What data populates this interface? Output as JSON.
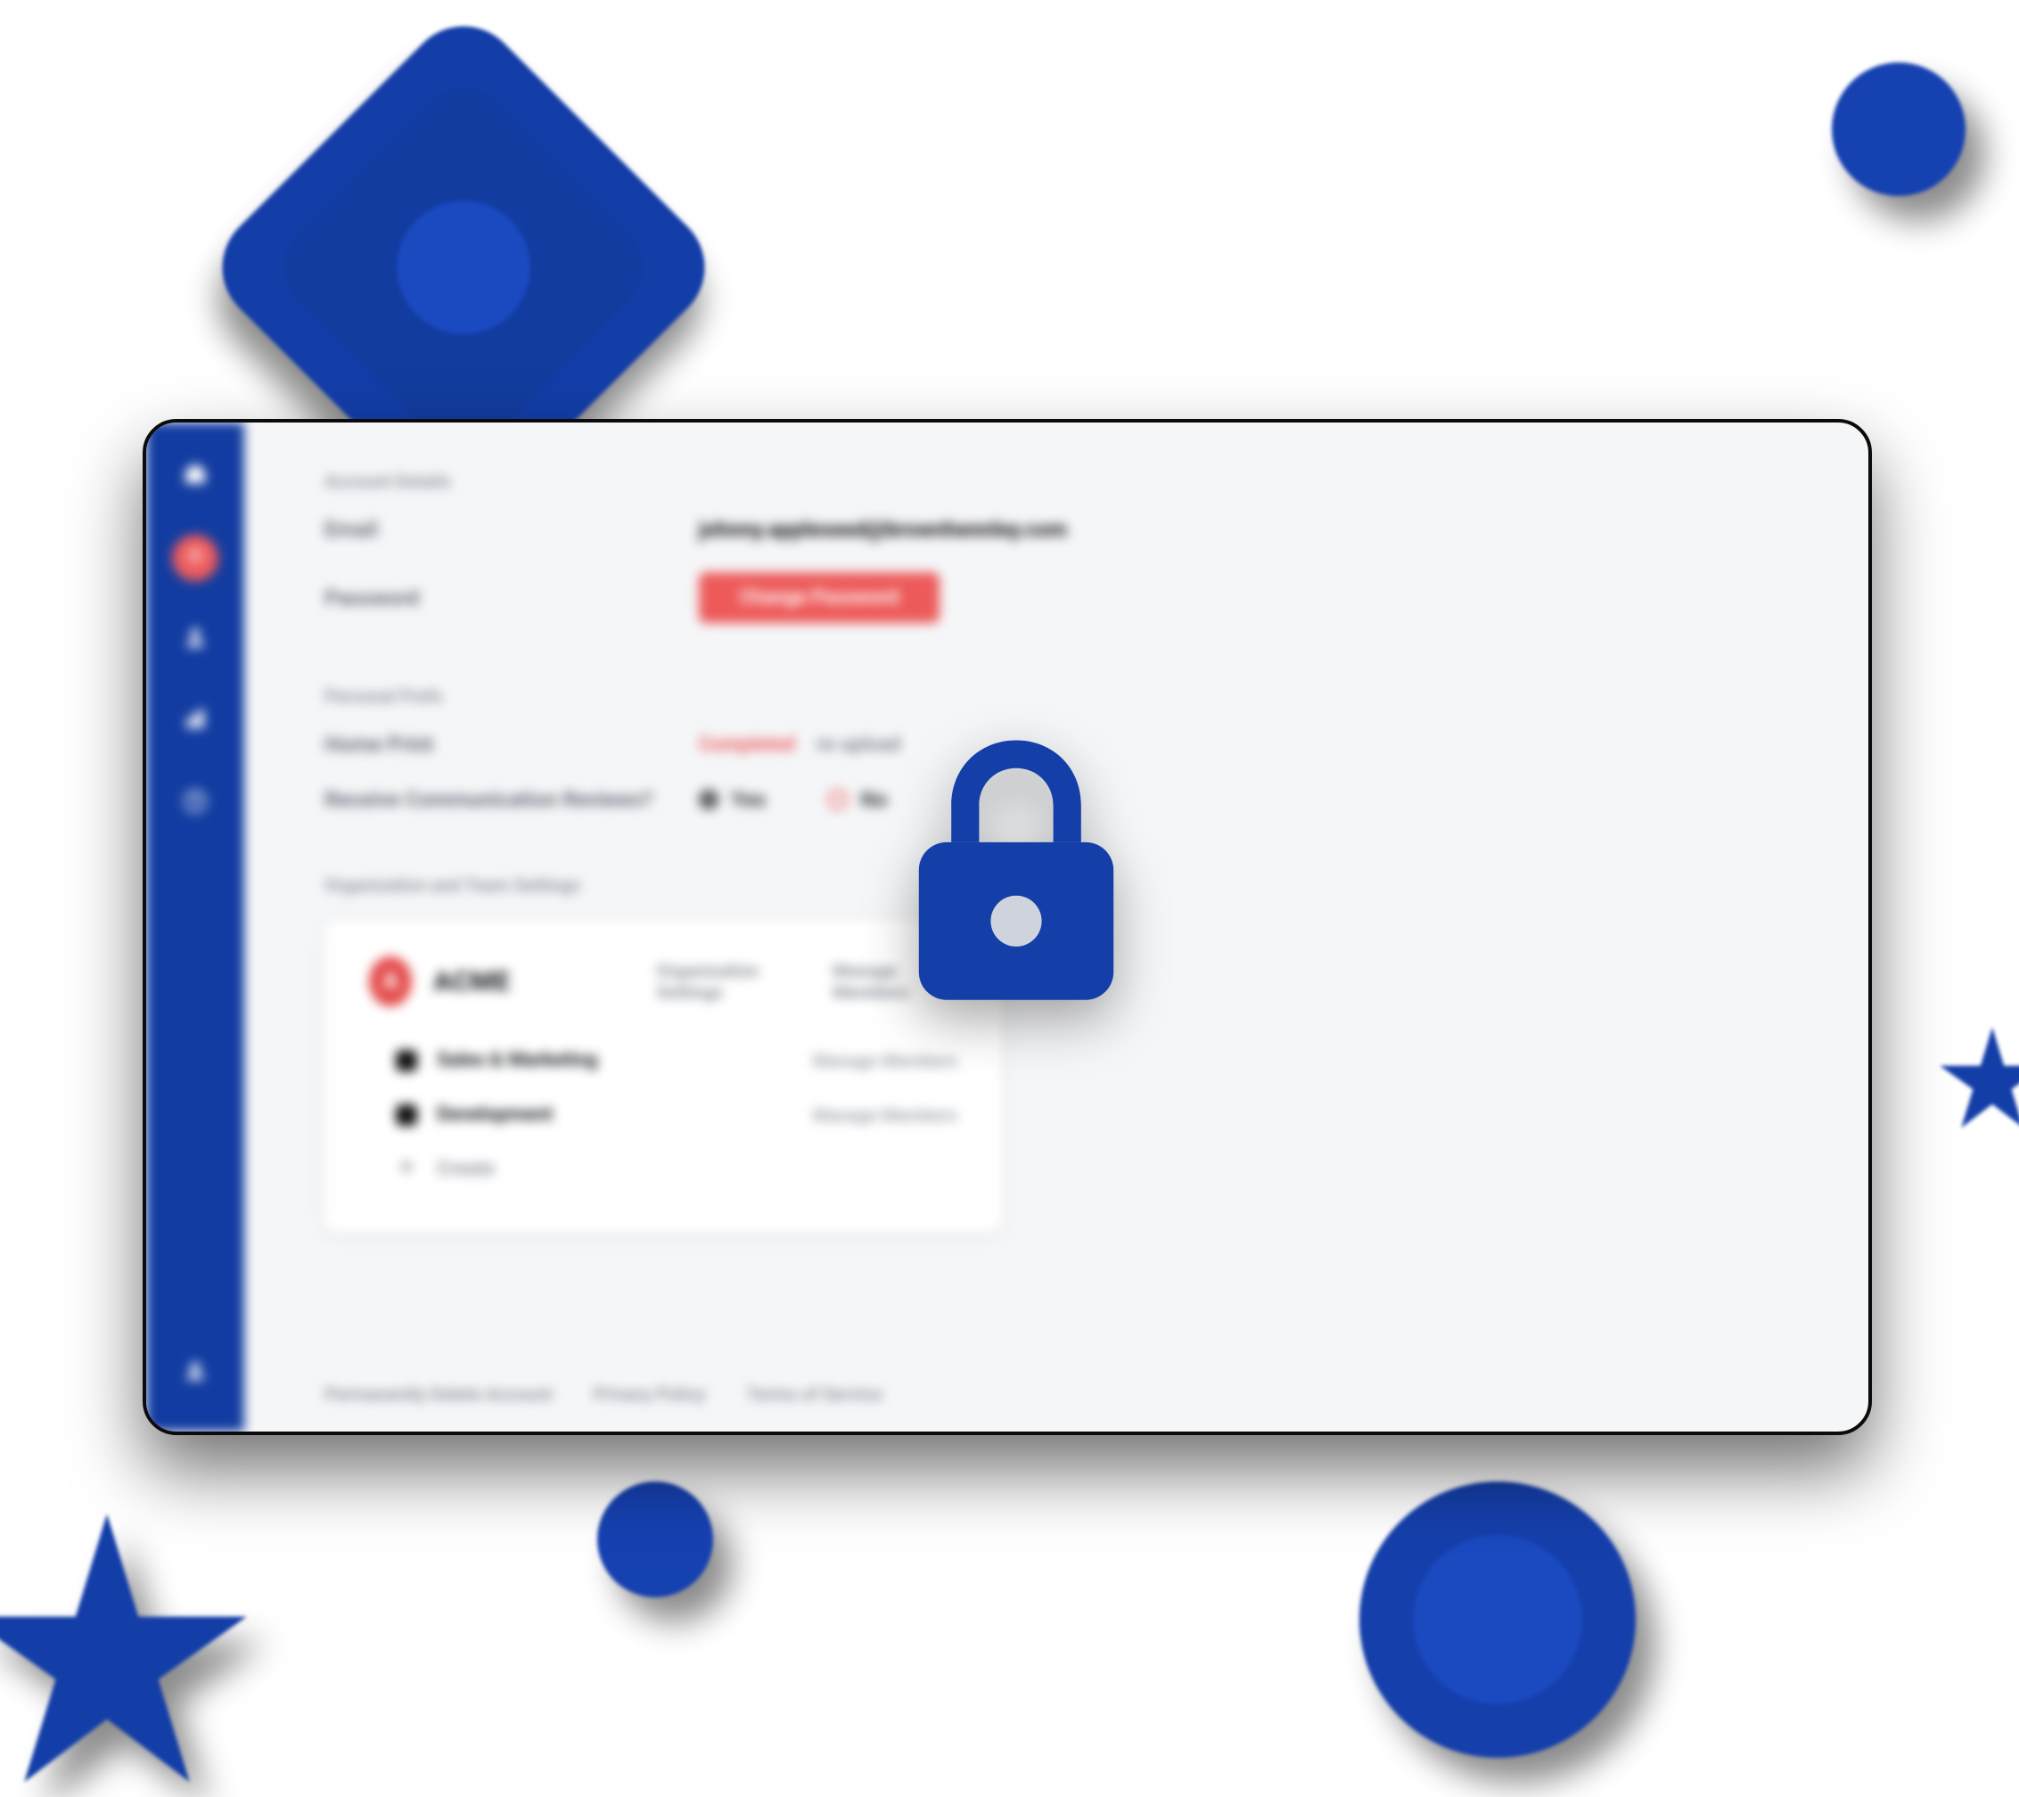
{
  "colors": {
    "brand_blue": "#133ea8",
    "accent_red": "#ed5a5a"
  },
  "sidebar": {
    "items": [
      {
        "name": "home-icon"
      },
      {
        "name": "settings-icon"
      },
      {
        "name": "users-icon"
      },
      {
        "name": "reports-icon"
      },
      {
        "name": "help-icon"
      }
    ],
    "footer_item": {
      "name": "profile-icon"
    }
  },
  "account": {
    "section_title": "Account Details",
    "email_label": "Email",
    "email_value": "johnny.appleseed@brownhennley.com",
    "password_label": "Password",
    "change_password_button": "Change Password"
  },
  "personal": {
    "section_title": "Personal Prefs",
    "print_label": "Home Print",
    "print_status": "Completed",
    "print_reupload": "re-upload",
    "comm_label": "Receive Communication Reviews?",
    "yes_label": "Yes",
    "no_label": "No",
    "selected": "yes"
  },
  "org": {
    "section_title": "Organization and Team Settings",
    "logo_letter": "A",
    "name": "ACME",
    "org_settings_link": "Organization Settings",
    "manage_members_link": "Manage Members",
    "teams": [
      {
        "name": "Sales & Marketing",
        "manage": "Manage Members"
      },
      {
        "name": "Development",
        "manage": "Manage Members"
      }
    ],
    "create_label": "Create"
  },
  "footer": {
    "delete": "Permanently Delete Account",
    "privacy": "Privacy Policy",
    "terms": "Terms of Service"
  },
  "overlay": {
    "icon_name": "lock-icon"
  }
}
